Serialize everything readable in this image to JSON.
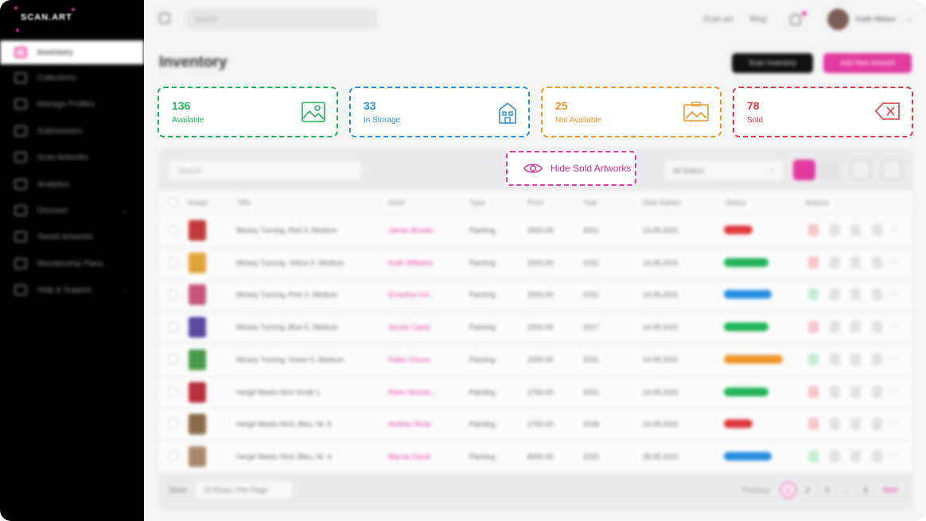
{
  "brand": {
    "logo": "SCAN.ART",
    "accent": "#e23a9e"
  },
  "sidebar": {
    "items": [
      {
        "label": "Inventory",
        "icon": "inventory-icon",
        "active": true
      },
      {
        "label": "Collections",
        "icon": "collections-icon"
      },
      {
        "label": "Manage Profiles",
        "icon": "profiles-icon"
      },
      {
        "label": "Submissions",
        "icon": "submissions-icon"
      },
      {
        "label": "Scan Artworks",
        "icon": "scan-icon"
      },
      {
        "label": "Analytics",
        "icon": "analytics-icon"
      },
      {
        "label": "Discover",
        "icon": "discover-icon",
        "chevron": "⌄"
      },
      {
        "label": "Saved Artworks",
        "icon": "bookmark-icon"
      },
      {
        "label": "Membership Plans",
        "icon": "membership-icon"
      },
      {
        "label": "Help & Support",
        "icon": "help-icon",
        "chevron": "⌄"
      }
    ]
  },
  "header": {
    "search_placeholder": "Search",
    "links": [
      "Scan.art",
      "Blog"
    ],
    "user_name": "Keith Wilson",
    "user_chevron": "⌄"
  },
  "page": {
    "title": "Inventory",
    "scan_button": "Scan Inventory",
    "add_button": "Add New Artwork"
  },
  "stats": [
    {
      "value": "136",
      "label": "Available",
      "color": "#1fb45a",
      "icon": "image-icon"
    },
    {
      "value": "33",
      "label": "In Storage",
      "color": "#2a8fe0",
      "icon": "building-icon"
    },
    {
      "value": "25",
      "label": "Not Available",
      "color": "#f0962a",
      "icon": "easel-icon"
    },
    {
      "value": "78",
      "label": "Sold",
      "color": "#e0393f",
      "icon": "delete-tag-icon"
    }
  ],
  "toolbar": {
    "search_placeholder": "Search",
    "hide_sold": "Hide Sold Artworks",
    "status_filter": "All Status",
    "status_arrow": "⌄"
  },
  "table": {
    "columns": [
      "Image",
      "Title",
      "Artist",
      "Type",
      "Price",
      "Year",
      "Date Added",
      "Status",
      "Actions"
    ],
    "rows": [
      {
        "title": "Mickey Turning, Red 3, Medium",
        "artist": "James Brooks",
        "type": "Painting",
        "price": "2000.00",
        "year": "2021",
        "date": "14.05.2021",
        "status": "sold",
        "thumb": "#c23a3a"
      },
      {
        "title": "Mickey Turning, Yellow 4, Medium",
        "artist": "Keith Williams",
        "type": "Painting",
        "price": "2000.00",
        "year": "2021",
        "date": "14.05.2021",
        "status": "available",
        "thumb": "#e0a43a"
      },
      {
        "title": "Mickey Turning, Pink 3, Medium",
        "artist": "Errantha Col...",
        "type": "Painting",
        "price": "2000.00",
        "year": "2021",
        "date": "14.05.2021",
        "status": "in storage",
        "thumb": "#c8557e"
      },
      {
        "title": "Mickey Turning, Blue 5, Medium",
        "artist": "Jennie Carter",
        "type": "Painting",
        "price": "2000.00",
        "year": "2017",
        "date": "14.05.2021",
        "status": "available",
        "thumb": "#5c4aa0"
      },
      {
        "title": "Mickey Turning, Green 5, Medium",
        "artist": "Pablo Clouzo",
        "type": "Painting",
        "price": "2000.00",
        "year": "2021",
        "date": "14.05.2021",
        "status": "not available",
        "thumb": "#4a9a48"
      },
      {
        "title": "Hergé Meets Hirst Small 1",
        "artist": "Peter Nichols...",
        "type": "Painting",
        "price": "2750.00",
        "year": "2021",
        "date": "14.05.2021",
        "status": "available",
        "thumb": "#b8323e"
      },
      {
        "title": "Hergé Meets Hirst, Bleu, Nr. 8",
        "artist": "Andrew Rudo",
        "type": "Painting",
        "price": "2750.00",
        "year": "2018",
        "date": "14.05.2021",
        "status": "sold",
        "thumb": "#8a6a4a"
      },
      {
        "title": "Hergé Meets Hirst, Bleu, Nr. 4",
        "artist": "Marnie David",
        "type": "Painting",
        "price": "8000.00",
        "year": "2020",
        "date": "28.05.2021",
        "status": "in storage",
        "thumb": "#a8886e"
      }
    ]
  },
  "status_colors": {
    "sold": "#e0393f",
    "available": "#1fb45a",
    "in storage": "#2a8fe0",
    "not available": "#f0962a"
  },
  "footer": {
    "show_label": "Show",
    "per_page": "10 Rows / Per Page",
    "prev": "Previous",
    "pages": [
      "1",
      "2",
      "3",
      "...",
      "8"
    ],
    "next": "Next"
  }
}
